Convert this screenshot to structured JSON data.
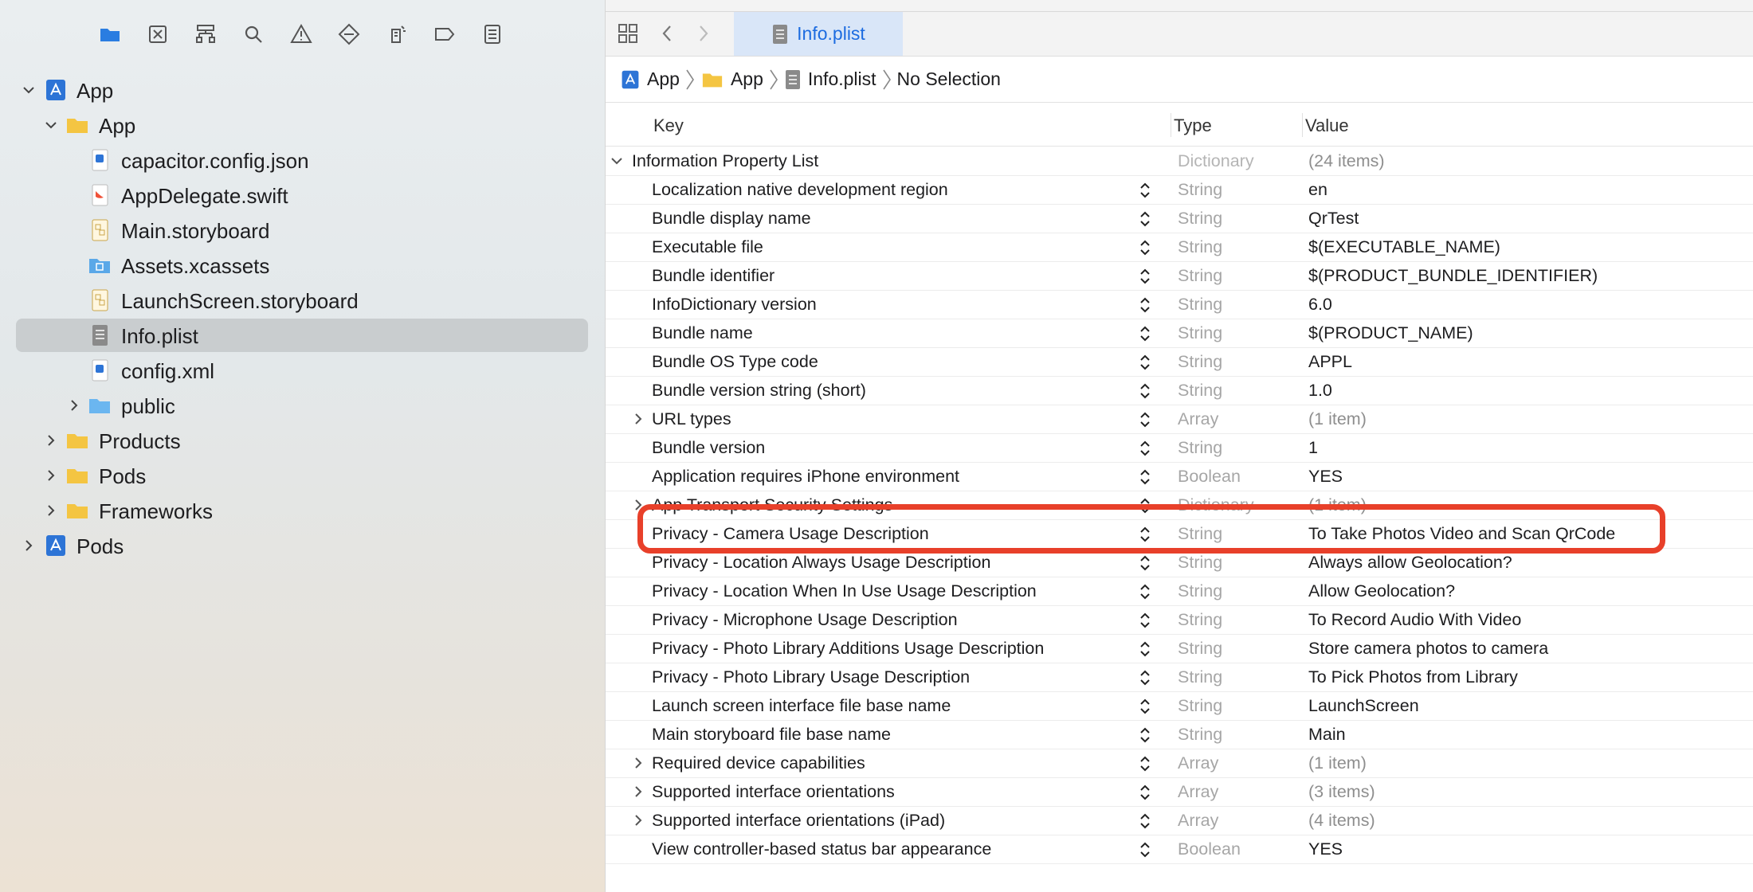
{
  "sidebar": {
    "toolbar_icons": [
      "folder-icon",
      "source-control-icon",
      "hierarchy-icon",
      "search-icon",
      "warning-icon",
      "test-icon",
      "debug-icon",
      "breakpoint-icon",
      "report-icon"
    ],
    "tree": [
      {
        "label": "App",
        "icon": "project-icon",
        "expanded": true
      },
      {
        "label": "App",
        "icon": "folder-icon",
        "expanded": true
      },
      {
        "label": "capacitor.config.json",
        "icon": "json-file-icon"
      },
      {
        "label": "AppDelegate.swift",
        "icon": "swift-file-icon"
      },
      {
        "label": "Main.storyboard",
        "icon": "storyboard-file-icon"
      },
      {
        "label": "Assets.xcassets",
        "icon": "assets-folder-icon"
      },
      {
        "label": "LaunchScreen.storyboard",
        "icon": "storyboard-file-icon"
      },
      {
        "label": "Info.plist",
        "icon": "plist-file-icon",
        "selected": true
      },
      {
        "label": "config.xml",
        "icon": "xml-file-icon"
      },
      {
        "label": "public",
        "icon": "blue-folder-icon",
        "expanded": false
      },
      {
        "label": "Products",
        "icon": "folder-icon",
        "expanded": false
      },
      {
        "label": "Pods",
        "icon": "folder-icon",
        "expanded": false
      },
      {
        "label": "Frameworks",
        "icon": "folder-icon",
        "expanded": false
      },
      {
        "label": "Pods",
        "icon": "project-icon",
        "expanded": false
      }
    ]
  },
  "editor": {
    "tab": {
      "label": "Info.plist"
    },
    "breadcrumb": [
      "App",
      "App",
      "Info.plist",
      "No Selection"
    ],
    "columns": {
      "key": "Key",
      "type": "Type",
      "value": "Value"
    },
    "root": {
      "key": "Information Property List",
      "type": "Dictionary",
      "value": "(24 items)"
    },
    "rows": [
      {
        "key": "Localization native development region",
        "type": "String",
        "value": "en"
      },
      {
        "key": "Bundle display name",
        "type": "String",
        "value": "QrTest"
      },
      {
        "key": "Executable file",
        "type": "String",
        "value": "$(EXECUTABLE_NAME)"
      },
      {
        "key": "Bundle identifier",
        "type": "String",
        "value": "$(PRODUCT_BUNDLE_IDENTIFIER)"
      },
      {
        "key": "InfoDictionary version",
        "type": "String",
        "value": "6.0"
      },
      {
        "key": "Bundle name",
        "type": "String",
        "value": "$(PRODUCT_NAME)"
      },
      {
        "key": "Bundle OS Type code",
        "type": "String",
        "value": "APPL"
      },
      {
        "key": "Bundle version string (short)",
        "type": "String",
        "value": "1.0"
      },
      {
        "key": "URL types",
        "type": "Array",
        "value": "(1 item)",
        "expandable": true
      },
      {
        "key": "Bundle version",
        "type": "String",
        "value": "1"
      },
      {
        "key": "Application requires iPhone environment",
        "type": "Boolean",
        "value": "YES"
      },
      {
        "key": "App Transport Security Settings",
        "type": "Dictionary",
        "value": "(1 item)",
        "expandable": true
      },
      {
        "key": "Privacy - Camera Usage Description",
        "type": "String",
        "value": "To Take Photos Video and Scan QrCode",
        "highlighted": true
      },
      {
        "key": "Privacy - Location Always Usage Description",
        "type": "String",
        "value": "Always allow Geolocation?"
      },
      {
        "key": "Privacy - Location When In Use Usage Description",
        "type": "String",
        "value": "Allow Geolocation?"
      },
      {
        "key": "Privacy - Microphone Usage Description",
        "type": "String",
        "value": "To Record Audio With Video"
      },
      {
        "key": "Privacy - Photo Library Additions Usage Description",
        "type": "String",
        "value": "Store camera photos to camera"
      },
      {
        "key": "Privacy - Photo Library Usage Description",
        "type": "String",
        "value": "To Pick Photos from Library"
      },
      {
        "key": "Launch screen interface file base name",
        "type": "String",
        "value": "LaunchScreen"
      },
      {
        "key": "Main storyboard file base name",
        "type": "String",
        "value": "Main"
      },
      {
        "key": "Required device capabilities",
        "type": "Array",
        "value": "(1 item)",
        "expandable": true
      },
      {
        "key": "Supported interface orientations",
        "type": "Array",
        "value": "(3 items)",
        "expandable": true
      },
      {
        "key": "Supported interface orientations (iPad)",
        "type": "Array",
        "value": "(4 items)",
        "expandable": true
      },
      {
        "key": "View controller-based status bar appearance",
        "type": "Boolean",
        "value": "YES"
      }
    ],
    "highlight_color": "#e8402a"
  }
}
